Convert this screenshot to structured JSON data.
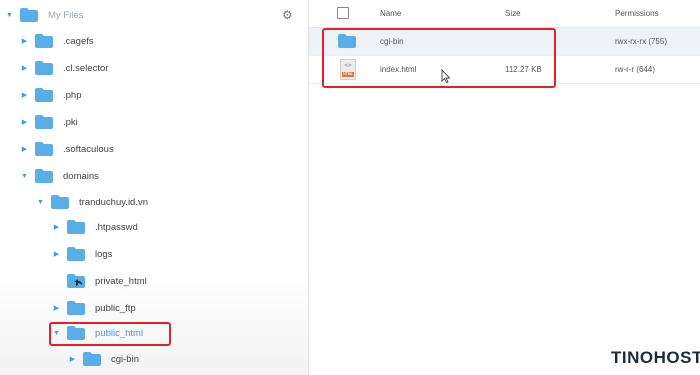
{
  "sidebar": {
    "root_label": "My Files",
    "items": [
      {
        "label": ".cagefs"
      },
      {
        "label": ".cl.selector"
      },
      {
        "label": ".php"
      },
      {
        "label": ".pki"
      },
      {
        "label": ".softaculous"
      },
      {
        "label": "domains"
      },
      {
        "label": "tranduchuy.id.vn"
      },
      {
        "label": ".htpasswd"
      },
      {
        "label": "logs"
      },
      {
        "label": "private_html"
      },
      {
        "label": "public_ftp"
      },
      {
        "label": "public_html"
      },
      {
        "label": "cgi-bin"
      }
    ]
  },
  "table": {
    "headers": {
      "name": "Name",
      "size": "Size",
      "permissions": "Permissions"
    },
    "rows": [
      {
        "name": "cgi-bin",
        "size": "",
        "permissions": "rwx-rx-rx (755)",
        "icon": "folder-icon"
      },
      {
        "name": "index.html",
        "size": "112.27 KB",
        "permissions": "rw-r-r (644)",
        "icon": "html-file-icon",
        "icon_tag": "HTML",
        "icon_code": "<>"
      }
    ]
  },
  "brand": {
    "text": "TINOHOST"
  },
  "colors": {
    "folder": "#5aaee8",
    "highlight": "#e4202a",
    "selected_row": "#eef1f6"
  }
}
